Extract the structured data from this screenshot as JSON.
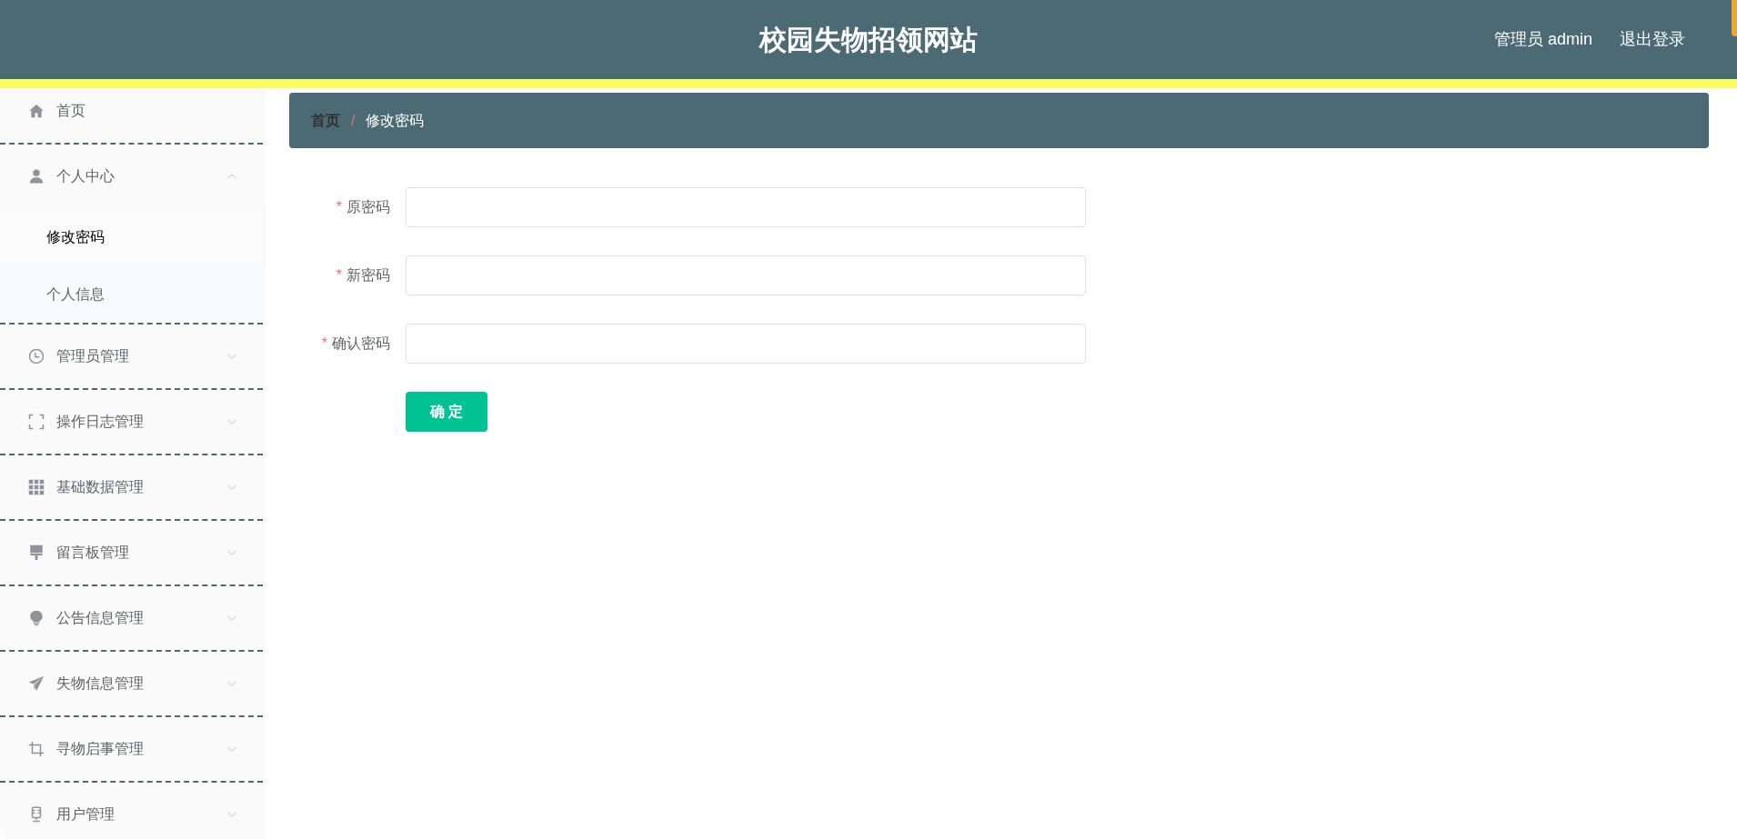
{
  "header": {
    "title": "校园失物招领网站",
    "user": "管理员 admin",
    "logout": "退出登录"
  },
  "sidebar": {
    "items": [
      {
        "kind": "link",
        "label": "首页"
      },
      {
        "kind": "submenu",
        "label": "个人中心",
        "expanded": true,
        "children": [
          {
            "label": "修改密码",
            "selected": true
          },
          {
            "label": "个人信息",
            "selected": false
          }
        ]
      },
      {
        "kind": "submenu",
        "label": "管理员管理",
        "expanded": false
      },
      {
        "kind": "submenu",
        "label": "操作日志管理",
        "expanded": false
      },
      {
        "kind": "submenu",
        "label": "基础数据管理",
        "expanded": false
      },
      {
        "kind": "submenu",
        "label": "留言板管理",
        "expanded": false
      },
      {
        "kind": "submenu",
        "label": "公告信息管理",
        "expanded": false
      },
      {
        "kind": "submenu",
        "label": "失物信息管理",
        "expanded": false
      },
      {
        "kind": "submenu",
        "label": "寻物启事管理",
        "expanded": false
      },
      {
        "kind": "submenu",
        "label": "用户管理",
        "expanded": false
      }
    ]
  },
  "breadcrumb": {
    "separator": "/",
    "items": [
      {
        "label": "首页"
      },
      {
        "label": "修改密码"
      }
    ]
  },
  "form": {
    "fields": [
      {
        "required_mark": "*",
        "label": "原密码"
      },
      {
        "required_mark": "*",
        "label": "新密码"
      },
      {
        "required_mark": "*",
        "label": "确认密码"
      }
    ],
    "submit": "确 定"
  }
}
